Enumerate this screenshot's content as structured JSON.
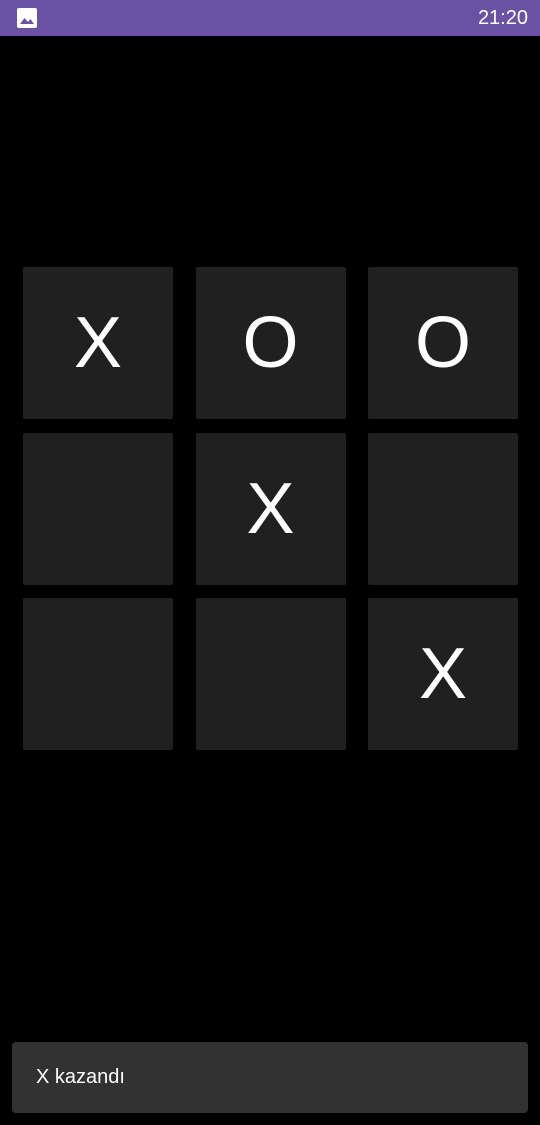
{
  "status_bar": {
    "time": "21:20",
    "left_icon": "gallery-icon",
    "background": "#6a51a3"
  },
  "board": {
    "cells": [
      "X",
      "O",
      "O",
      "",
      "X",
      "",
      "",
      "",
      "X"
    ],
    "cell_color": "#202020",
    "mark_color": "#ffffff"
  },
  "snackbar": {
    "message": "X kazandı"
  }
}
